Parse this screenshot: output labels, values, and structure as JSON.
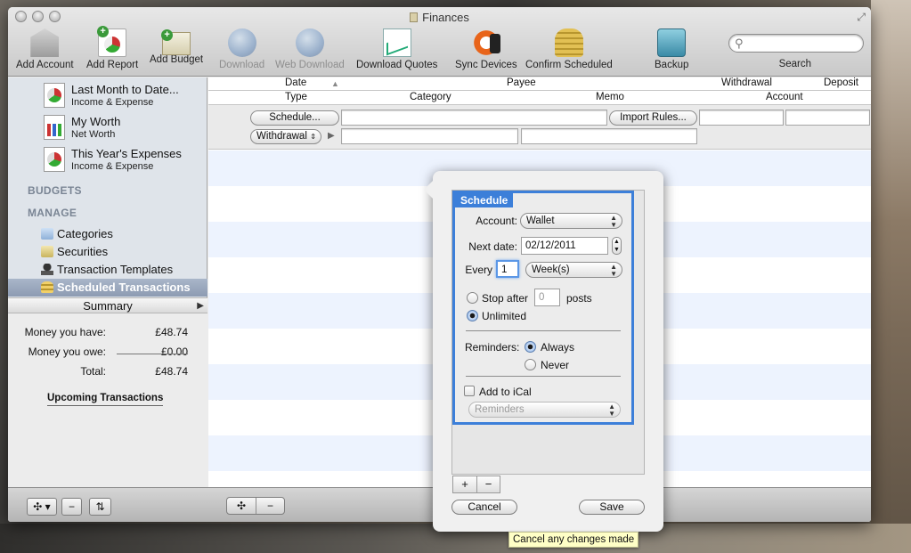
{
  "window": {
    "title": "Finances"
  },
  "toolbar": {
    "items": [
      {
        "label": "Add Account",
        "icon": "bank-icon",
        "enabled": true
      },
      {
        "label": "Add Report",
        "icon": "report-icon",
        "enabled": true
      },
      {
        "label": "Add Budget",
        "icon": "budget-icon",
        "enabled": true
      },
      {
        "label": "Download",
        "icon": "download-icon",
        "enabled": false
      },
      {
        "label": "Web Download",
        "icon": "web-download-icon",
        "enabled": false
      },
      {
        "label": "Download Quotes",
        "icon": "quotes-icon",
        "enabled": true
      },
      {
        "label": "Sync Devices",
        "icon": "sync-icon",
        "enabled": true
      },
      {
        "label": "Confirm Scheduled",
        "icon": "coins-icon",
        "enabled": true
      },
      {
        "label": "Backup",
        "icon": "backup-icon",
        "enabled": true
      }
    ],
    "search_label": "Search",
    "search_placeholder": ""
  },
  "sidebar": {
    "reports": [
      {
        "title": "Last Month to Date...",
        "subtitle": "Income & Expense",
        "icon": "pie-chart-icon"
      },
      {
        "title": "My Worth",
        "subtitle": "Net Worth",
        "icon": "bar-chart-icon"
      },
      {
        "title": "This Year's Expenses",
        "subtitle": "Income & Expense",
        "icon": "pie-chart-icon"
      }
    ],
    "budgets_heading": "BUDGETS",
    "manage_heading": "MANAGE",
    "manage_items": [
      {
        "label": "Categories",
        "icon": "folder-icon",
        "selected": false
      },
      {
        "label": "Securities",
        "icon": "securities-icon",
        "selected": false
      },
      {
        "label": "Transaction Templates",
        "icon": "stamp-icon",
        "selected": false
      },
      {
        "label": "Scheduled Transactions",
        "icon": "coins-icon",
        "selected": true
      }
    ],
    "summary": {
      "title": "Summary",
      "rows": [
        {
          "label": "Money you have:",
          "value": "£48.74"
        },
        {
          "label": "Money you owe:",
          "value": "£0.00"
        },
        {
          "label": "Total:",
          "value": "£48.74"
        }
      ],
      "upcoming": "Upcoming Transactions"
    }
  },
  "register": {
    "header_row1": {
      "date": "Date",
      "payee": "Payee",
      "withdrawal": "Withdrawal",
      "deposit": "Deposit"
    },
    "header_row2": {
      "type": "Type",
      "category": "Category",
      "memo": "Memo",
      "account": "Account"
    },
    "schedule_button": "Schedule...",
    "import_rules_button": "Import Rules...",
    "type_select": "Withdrawal"
  },
  "popover": {
    "section_title": "Schedule",
    "account_label": "Account:",
    "account_value": "Wallet",
    "next_date_label": "Next date:",
    "next_date_value": "02/12/2011",
    "every_label": "Every",
    "every_value": "1",
    "period_value": "Week(s)",
    "stop_after_label": "Stop after",
    "stop_after_value": "0",
    "posts_label": "posts",
    "unlimited_label": "Unlimited",
    "reminders_label": "Reminders:",
    "always_label": "Always",
    "never_label": "Never",
    "ical_label": "Add to iCal",
    "reminders_select": "Reminders",
    "cancel_label": "Cancel",
    "save_label": "Save",
    "tooltip": "Cancel any changes made"
  }
}
